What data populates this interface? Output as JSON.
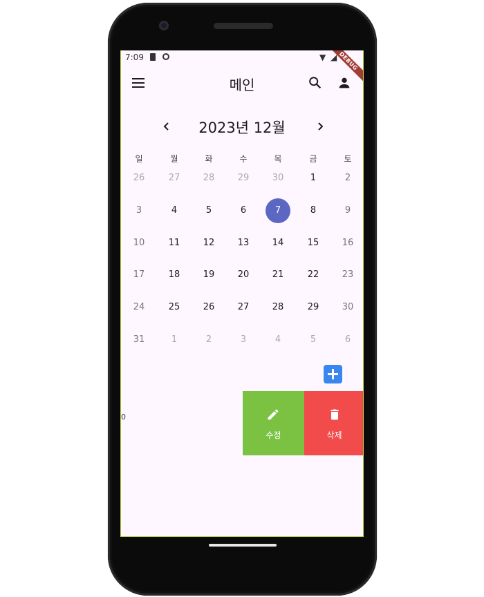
{
  "status": {
    "time": "7:09"
  },
  "debug_banner": "DEBUG",
  "appbar": {
    "title": "메인"
  },
  "calendar": {
    "month_title": "2023년 12월",
    "weekdays": [
      "일",
      "월",
      "화",
      "수",
      "목",
      "금",
      "토"
    ],
    "selected_day": "7",
    "weeks": [
      [
        "26",
        "27",
        "28",
        "29",
        "30",
        "1",
        "2"
      ],
      [
        "3",
        "4",
        "5",
        "6",
        "7",
        "8",
        "9"
      ],
      [
        "10",
        "11",
        "12",
        "13",
        "14",
        "15",
        "16"
      ],
      [
        "17",
        "18",
        "19",
        "20",
        "21",
        "22",
        "23"
      ],
      [
        "24",
        "25",
        "26",
        "27",
        "28",
        "29",
        "30"
      ],
      [
        "31",
        "1",
        "2",
        "3",
        "4",
        "5",
        "6"
      ]
    ]
  },
  "list": {
    "item_text": "0"
  },
  "actions": {
    "edit_label": "수정",
    "delete_label": "삭제"
  },
  "colors": {
    "accent": "#5b67c3",
    "edit": "#7bc142",
    "delete": "#f14b4b",
    "add": "#3a86f0",
    "background": "#fef7ff"
  }
}
